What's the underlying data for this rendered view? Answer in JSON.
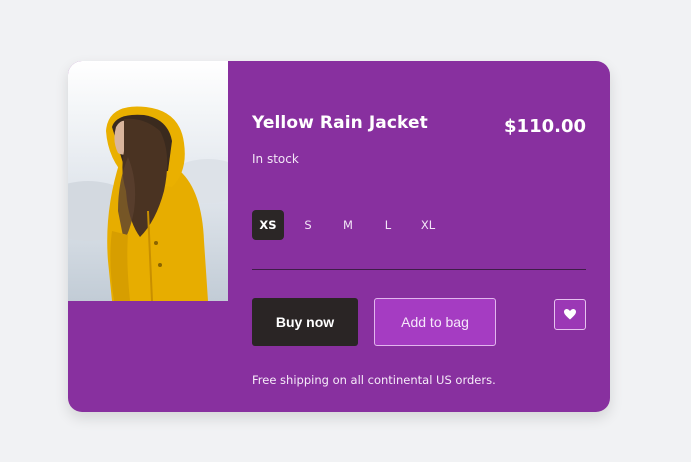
{
  "product": {
    "title": "Yellow Rain Jacket",
    "price": "$110.00",
    "stock": "In stock",
    "image": "woman-in-yellow-raincoat-photo"
  },
  "sizes": [
    {
      "label": "XS",
      "selected": true
    },
    {
      "label": "S",
      "selected": false
    },
    {
      "label": "M",
      "selected": false
    },
    {
      "label": "L",
      "selected": false
    },
    {
      "label": "XL",
      "selected": false
    }
  ],
  "actions": {
    "buy_label": "Buy now",
    "bag_label": "Add to bag",
    "favorite_icon": "heart-icon"
  },
  "footer": {
    "shipping": "Free shipping on all continental US orders."
  },
  "colors": {
    "card": "#88309f",
    "page": "#f1f2f4",
    "dark_button": "#2a2525",
    "bag_button": "#a53cc2",
    "jacket": "#e7ad00"
  }
}
